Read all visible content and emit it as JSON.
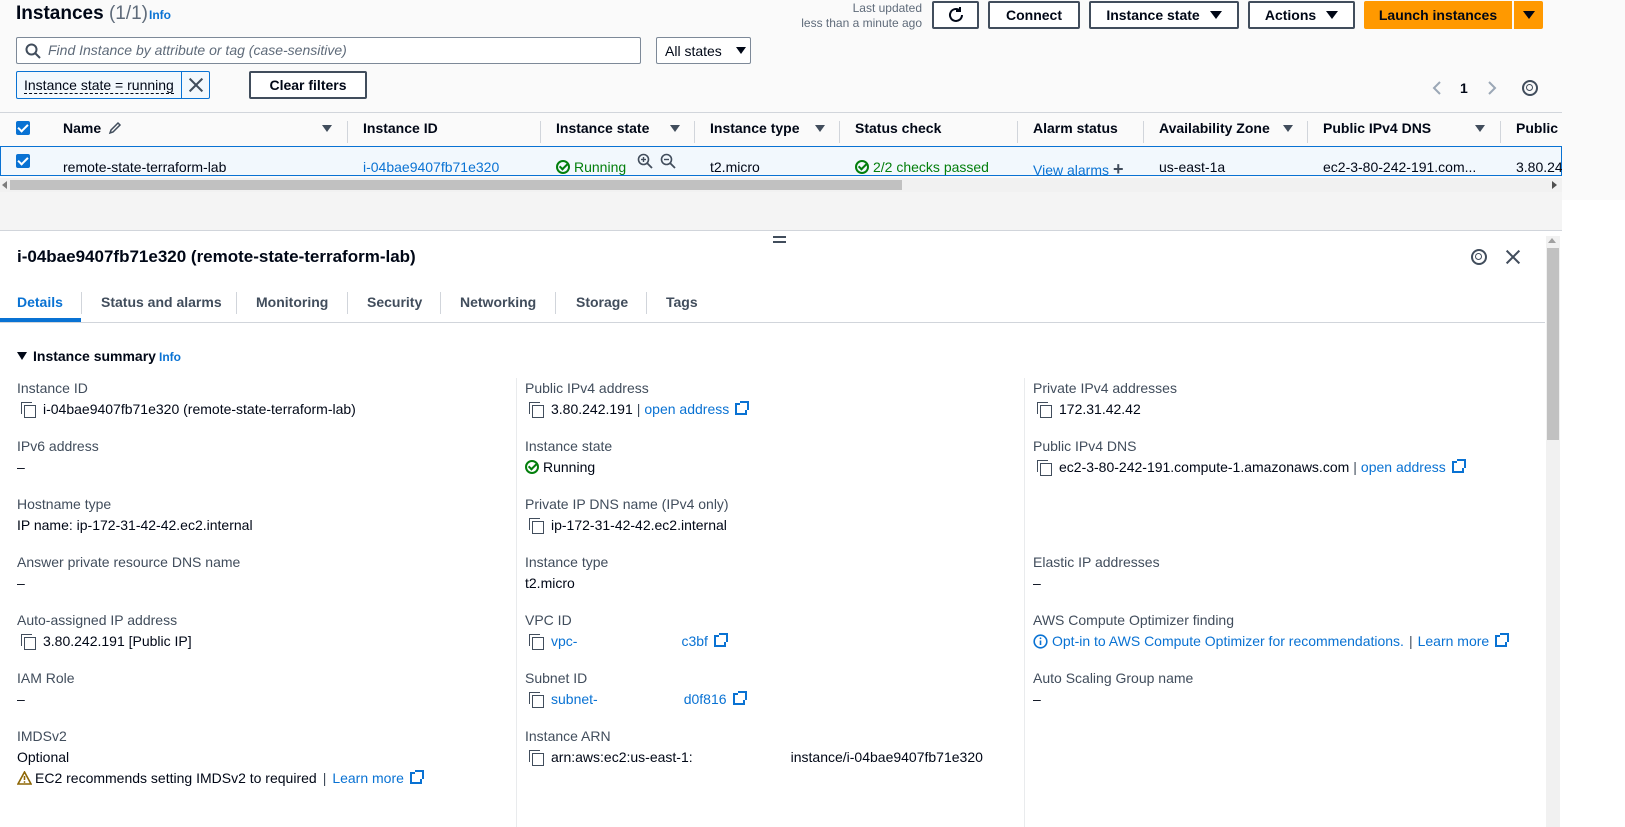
{
  "header": {
    "title": "Instances",
    "count": "(1/1)",
    "info": "Info",
    "last_updated_line1": "Last updated",
    "last_updated_line2": "less than a minute ago",
    "connect": "Connect",
    "instance_state": "Instance state",
    "actions": "Actions",
    "launch": "Launch instances"
  },
  "filter": {
    "search_placeholder": "Find Instance by attribute or tag (case-sensitive)",
    "states_select": "All states",
    "token": "Instance state = running",
    "clear": "Clear filters",
    "page": "1"
  },
  "table": {
    "columns": [
      "Name",
      "Instance ID",
      "Instance state",
      "Instance type",
      "Status check",
      "Alarm status",
      "Availability Zone",
      "Public IPv4 DNS",
      "Public I"
    ],
    "row": {
      "name": "remote-state-terraform-lab",
      "instance_id": "i-04bae9407fb71e320",
      "state": "Running",
      "type": "t2.micro",
      "status_check": "2/2 checks passed",
      "alarm": "View alarms",
      "az": "us-east-1a",
      "dns": "ec2-3-80-242-191.com...",
      "public_ip": "3.80.24"
    }
  },
  "detail": {
    "title": "i-04bae9407fb71e320 (remote-state-terraform-lab)",
    "tabs": [
      "Details",
      "Status and alarms",
      "Monitoring",
      "Security",
      "Networking",
      "Storage",
      "Tags"
    ],
    "section_title": "Instance summary",
    "section_info": "Info",
    "col1": {
      "instance_id_label": "Instance ID",
      "instance_id_value": "i-04bae9407fb71e320 (remote-state-terraform-lab)",
      "ipv6_label": "IPv6 address",
      "ipv6_value": "–",
      "hostname_label": "Hostname type",
      "hostname_value": "IP name: ip-172-31-42-42.ec2.internal",
      "answer_dns_label": "Answer private resource DNS name",
      "answer_dns_value": "–",
      "auto_ip_label": "Auto-assigned IP address",
      "auto_ip_value": "3.80.242.191 [Public IP]",
      "iam_label": "IAM Role",
      "iam_value": "–",
      "imds_label": "IMDSv2",
      "imds_value": "Optional",
      "imds_warning": "EC2 recommends setting IMDSv2 to required",
      "imds_learn": "Learn more"
    },
    "col2": {
      "public_ip_label": "Public IPv4 address",
      "public_ip_value": "3.80.242.191",
      "open_address": "open address",
      "state_label": "Instance state",
      "state_value": "Running",
      "private_dns_label": "Private IP DNS name (IPv4 only)",
      "private_dns_value": "ip-172-31-42-42.ec2.internal",
      "type_label": "Instance type",
      "type_value": "t2.micro",
      "vpc_label": "VPC ID",
      "vpc_prefix": "vpc-",
      "vpc_suffix": "c3bf",
      "subnet_label": "Subnet ID",
      "subnet_prefix": "subnet-",
      "subnet_suffix": "d0f816",
      "arn_label": "Instance ARN",
      "arn_prefix": "arn:aws:ec2:us-east-1:",
      "arn_suffix": "instance/i-04bae9407fb71e320"
    },
    "col3": {
      "private_ip_label": "Private IPv4 addresses",
      "private_ip_value": "172.31.42.42",
      "public_dns_label": "Public IPv4 DNS",
      "public_dns_value": "ec2-3-80-242-191.compute-1.amazonaws.com",
      "open_address": "open address",
      "elastic_label": "Elastic IP addresses",
      "elastic_value": "–",
      "optimizer_label": "AWS Compute Optimizer finding",
      "optimizer_value": "Opt-in to AWS Compute Optimizer for recommendations.",
      "optimizer_learn": "Learn more",
      "asg_label": "Auto Scaling Group name",
      "asg_value": "–"
    }
  }
}
